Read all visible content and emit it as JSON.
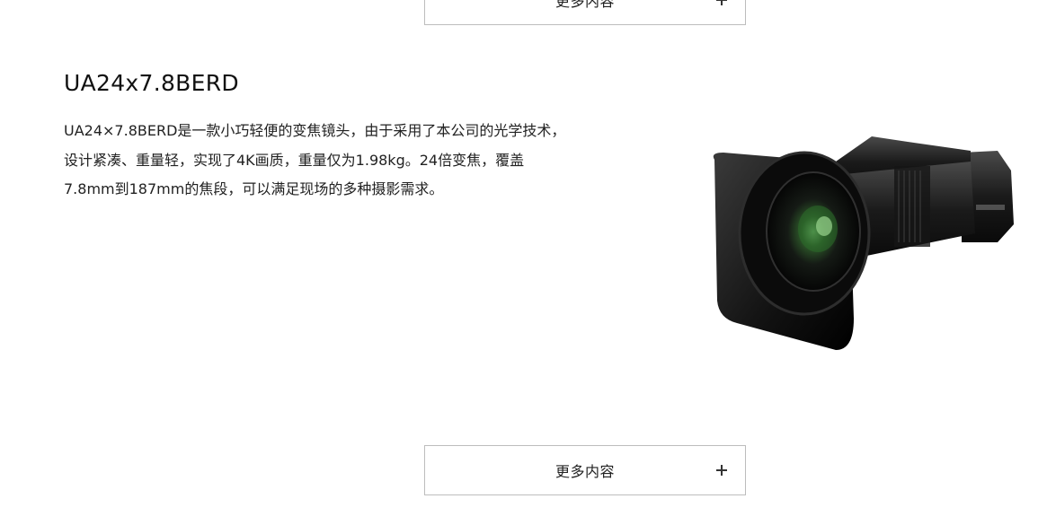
{
  "top_button": {
    "label": "更多内容"
  },
  "product": {
    "title": "UA24x7.8BERD",
    "description": "UA24×7.8BERD是一款小巧轻便的变焦镜头，由于采用了本公司的光学技术，设计紧凑、重量轻，实现了4K画质，重量仅为1.98kg。24倍变焦，覆盖7.8mm到187mm的焦段，可以满足现场的多种摄影需求。",
    "image_icon": "camera-lens-image"
  },
  "bottom_button": {
    "label": "更多内容"
  }
}
